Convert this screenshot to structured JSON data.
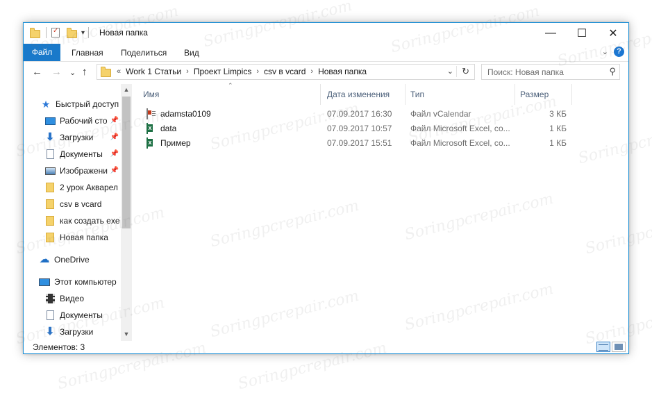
{
  "window": {
    "title": "Новая папка",
    "controls": {
      "minimize": "—",
      "maximize": "☐",
      "close": "✕"
    }
  },
  "ribbon": {
    "tabs": [
      "Файл",
      "Главная",
      "Поделиться",
      "Вид"
    ],
    "collapse_icon": "chevron-down-icon",
    "help_icon": "?"
  },
  "address_bar": {
    "overflow": "«",
    "crumbs": [
      "Work 1 Статьи",
      "Проект Limpics",
      "csv в vcard",
      "Новая папка"
    ],
    "search_placeholder": "Поиск: Новая папка"
  },
  "nav_pane": {
    "quick_access": "Быстрый доступ",
    "pinned": [
      {
        "label": "Рабочий сто",
        "icon": "desktop-icon"
      },
      {
        "label": "Загрузки",
        "icon": "downloads-icon"
      },
      {
        "label": "Документы",
        "icon": "documents-icon"
      },
      {
        "label": "Изображени",
        "icon": "pictures-icon"
      }
    ],
    "recent": [
      {
        "label": "2 урок Акварел"
      },
      {
        "label": "csv в vcard"
      },
      {
        "label": "как создать exe"
      },
      {
        "label": "Новая папка"
      }
    ],
    "onedrive": "OneDrive",
    "this_pc": "Этот компьютер",
    "pc_items": [
      {
        "label": "Видео",
        "icon": "video-icon"
      },
      {
        "label": "Документы",
        "icon": "documents-icon"
      },
      {
        "label": "Загрузки",
        "icon": "downloads-icon"
      }
    ]
  },
  "file_list": {
    "columns": [
      "Имя",
      "Дата изменения",
      "Тип",
      "Размер"
    ],
    "rows": [
      {
        "name": "adamsta0109",
        "date": "07.09.2017 16:30",
        "type": "Файл vCalendar",
        "size": "3 КБ",
        "icon": "vcard-file-icon"
      },
      {
        "name": "data",
        "date": "07.09.2017 10:57",
        "type": "Файл Microsoft Excel, со...",
        "size": "1 КБ",
        "icon": "excel-file-icon"
      },
      {
        "name": "Пример",
        "date": "07.09.2017 15:51",
        "type": "Файл Microsoft Excel, со...",
        "size": "1 КБ",
        "icon": "excel-file-icon"
      }
    ]
  },
  "status_bar": {
    "items_count": "Элементов: 3"
  },
  "watermark": "Soringpcrepair.com",
  "colors": {
    "accent": "#1979ca",
    "folder": "#f5d26b",
    "excel": "#1d7044"
  }
}
